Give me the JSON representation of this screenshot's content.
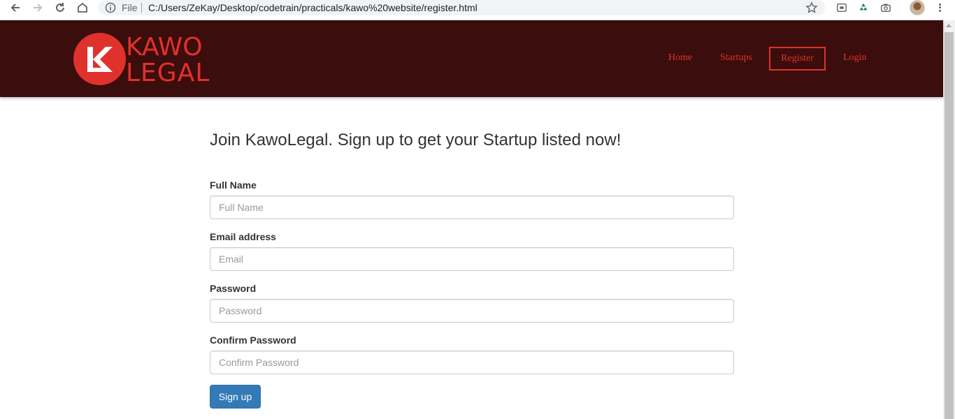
{
  "browser": {
    "file_label": "File",
    "url": "C:/Users/ZeKay/Desktop/codetrain/practicals/kawo%20website/register.html",
    "icons": [
      "back-icon",
      "forward-icon",
      "reload-icon",
      "home-icon",
      "info-icon",
      "star-icon",
      "cast-icon",
      "recycle-icon",
      "camera-icon",
      "profile-avatar",
      "menu-icon"
    ]
  },
  "site": {
    "logo": {
      "line1": "KAWO",
      "line2": "LEGAL",
      "color": "#e0312c"
    },
    "header_bg": "#3b0d0c",
    "nav": [
      {
        "label": "Home",
        "active": false
      },
      {
        "label": "Startups",
        "active": false
      },
      {
        "label": "Register",
        "active": true
      },
      {
        "label": "Login",
        "active": false
      }
    ]
  },
  "form": {
    "title": "Join KawoLegal. Sign up to get your Startup listed now!",
    "fields": [
      {
        "label": "Full Name",
        "placeholder": "Full Name"
      },
      {
        "label": "Email address",
        "placeholder": "Email"
      },
      {
        "label": "Password",
        "placeholder": "Password"
      },
      {
        "label": "Confirm Password",
        "placeholder": "Confirm Password"
      }
    ],
    "submit_label": "Sign up",
    "button_color": "#337ab7"
  }
}
